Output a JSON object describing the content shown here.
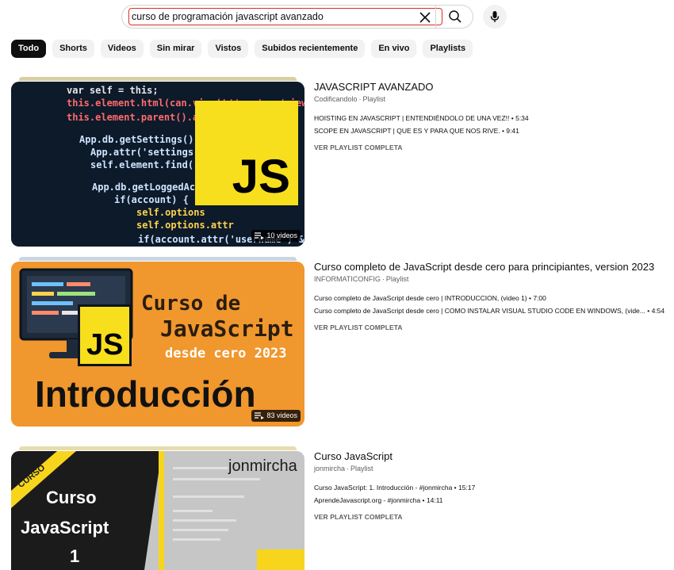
{
  "search": {
    "query": "curso de programación javascript avanzado"
  },
  "chips": [
    "Todo",
    "Shorts",
    "Videos",
    "Sin mirar",
    "Vistos",
    "Subidos recientemente",
    "En vivo",
    "Playlists"
  ],
  "results": [
    {
      "title": "JAVASCRIPT AVANZADO",
      "channel": "Codificandolo",
      "type": "Playlist",
      "video_count": "10 videos",
      "videos": [
        "HOISTING EN JAVASCRIPT | ENTENDIÉNDOLO DE UNA VEZ!! • 5:34",
        "SCOPE EN JAVASCRIPT | QUE ES Y PARA QUE NOS RIVE. • 9:41"
      ],
      "view_full": "VER PLAYLIST COMPLETA",
      "thumb_text": "JS",
      "thumb_code": [
        "var self = this;",
        "this.element.html(can.view('//app/src/views/sig",
        "this.element.parent().add",
        "App.db.getSettings().then",
        "App.attr('settings',",
        "self.element.find('#",
        "App.db.getLoggedAcco",
        "if(account) {",
        "self.options",
        "self.options.attr",
        "if(account.attr('username') && acco"
      ]
    },
    {
      "title": "Curso completo de JavaScript desde cero para principiantes, version 2023",
      "channel": "INFORMATICONFIG",
      "type": "Playlist",
      "video_count": "83 videos",
      "videos": [
        "Curso completo de JavaScript desde cero | INTRODUCCION, (video 1) • 7:00",
        "Curso completo de JavaScript desde cero | COMO INSTALAR VISUAL STUDIO CODE EN WINDOWS, (vide... • 4:54"
      ],
      "view_full": "VER PLAYLIST COMPLETA",
      "thumb_title1": "Curso de",
      "thumb_title2": "JavaScript",
      "thumb_title3": "desde cero 2023",
      "thumb_big": "Introducción",
      "thumb_js": "JS"
    },
    {
      "title": "Curso JavaScript",
      "channel": "jonmircha",
      "type": "Playlist",
      "videos": [
        "Curso JavaScript: 1. Introducción - #jonmircha • 15:17",
        "AprendeJavascript.org - #jonmircha • 14:11"
      ],
      "view_full": "VER PLAYLIST COMPLETA",
      "thumb_banner": "CURSO",
      "thumb_line1": "Curso",
      "thumb_line2": "JavaScript",
      "thumb_line3": "1",
      "thumb_brand": "jonmircha"
    }
  ],
  "colors": {
    "chip_active_bg": "#0f0f0f",
    "chip_bg": "#f2f2f2",
    "search_highlight": "#d93025",
    "js_yellow": "#f7df1e",
    "orange": "#f0972e"
  }
}
